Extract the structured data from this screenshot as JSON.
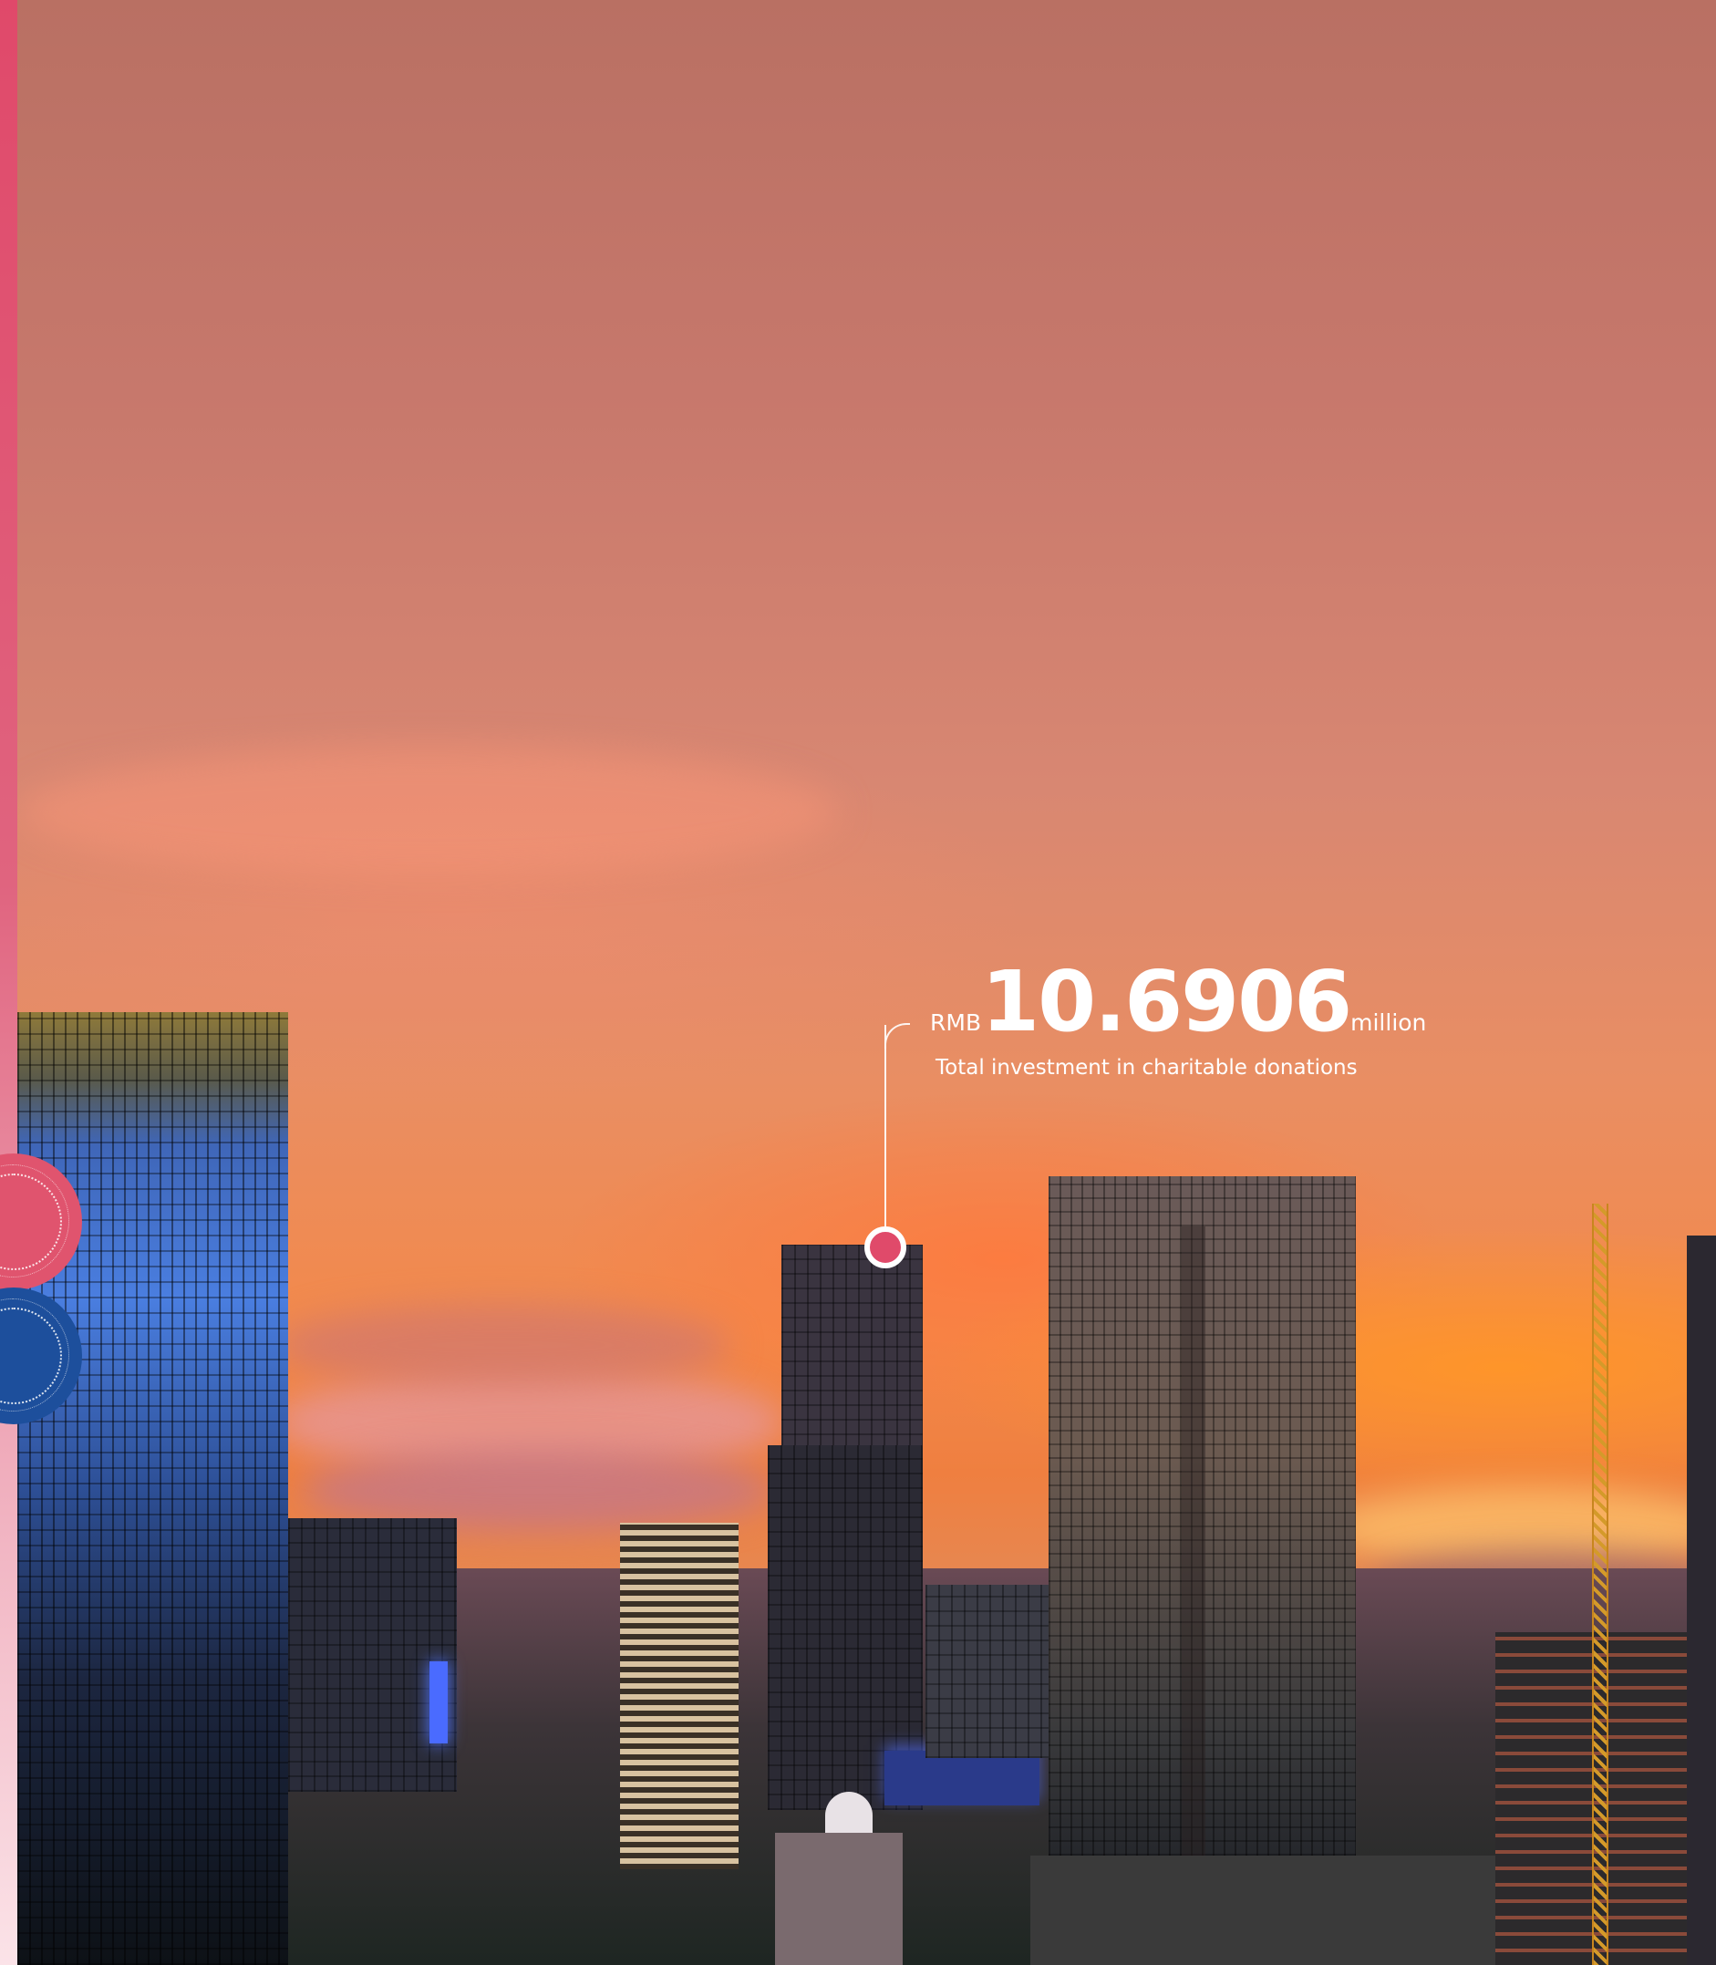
{
  "stat": {
    "currency": "RMB",
    "value": "10.6906",
    "unit": "million",
    "caption": "Total investment in charitable donations"
  },
  "colors": {
    "accent_pink": "#e0496a",
    "accent_blue": "#1d4f9c"
  },
  "icons": [
    "pink-circle-icon",
    "blue-circle-icon",
    "location-marker-icon"
  ]
}
